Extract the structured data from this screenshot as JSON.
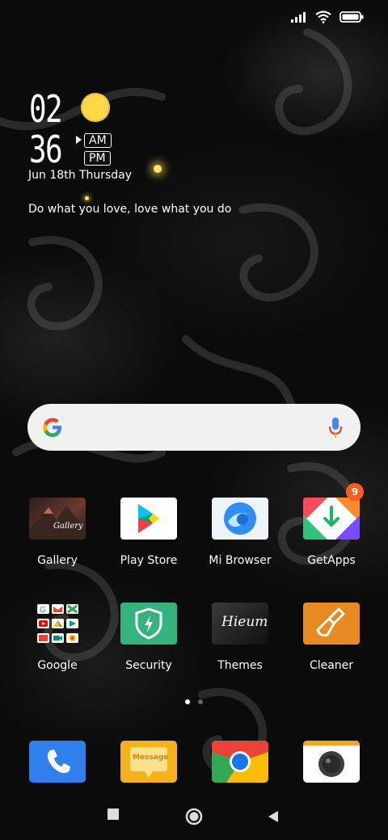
{
  "status_bar": {
    "signal_icon": "signal-icon",
    "wifi_icon": "wifi-icon",
    "battery_icon": "battery-icon"
  },
  "clock_widget": {
    "hour": "02",
    "minute": "36",
    "am_label": "AM",
    "pm_label": "PM",
    "date": "Jun 18th Thursday",
    "quote": "Do what you love, love what you do",
    "weather_icon": "sun-icon"
  },
  "search_bar": {
    "logo": "google-logo",
    "mic_icon": "mic-icon"
  },
  "apps_row1": [
    {
      "label": "Gallery",
      "icon": "gallery-icon",
      "icon_text": "Gallery"
    },
    {
      "label": "Play Store",
      "icon": "play-store-icon"
    },
    {
      "label": "Mi Browser",
      "icon": "mi-browser-icon"
    },
    {
      "label": "GetApps",
      "icon": "getapps-icon",
      "badge": "9"
    }
  ],
  "apps_row2": [
    {
      "label": "Google",
      "icon": "google-folder-icon"
    },
    {
      "label": "Security",
      "icon": "security-icon"
    },
    {
      "label": "Themes",
      "icon": "themes-icon",
      "icon_text": "Hieum"
    },
    {
      "label": "Cleaner",
      "icon": "cleaner-icon"
    }
  ],
  "page_indicator": {
    "pages": 2,
    "current": 1
  },
  "dock": [
    {
      "icon": "phone-icon"
    },
    {
      "icon": "messaging-icon",
      "icon_text": "Message"
    },
    {
      "icon": "chrome-icon"
    },
    {
      "icon": "camera-icon"
    }
  ],
  "nav_bar": {
    "recents": "recents-icon",
    "home": "home-icon",
    "back": "back-icon"
  }
}
